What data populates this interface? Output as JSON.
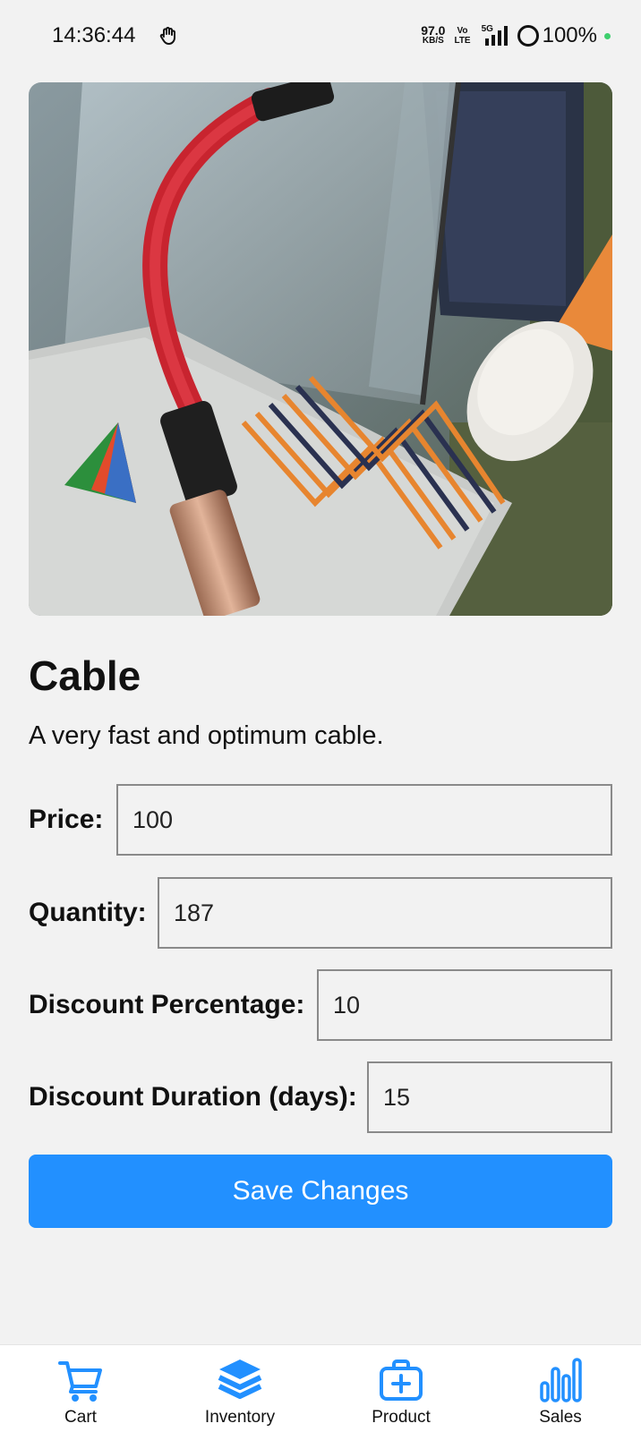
{
  "status_bar": {
    "time": "14:36:44",
    "net_speed_value": "97.0",
    "net_speed_unit": "KB/S",
    "volte_top": "Vo",
    "volte_bottom": "LTE",
    "network": "5G",
    "battery": "100%"
  },
  "product": {
    "image_icon": "product-photo-cable",
    "title": "Cable",
    "description": "A very fast and optimum cable."
  },
  "form": {
    "price": {
      "label": "Price:",
      "value": "100"
    },
    "quantity": {
      "label": "Quantity:",
      "value": "187"
    },
    "discount_percentage": {
      "label": "Discount Percentage:",
      "value": "10"
    },
    "discount_duration": {
      "label": "Discount Duration (days):",
      "value": "15"
    }
  },
  "save_label": "Save Changes",
  "nav": {
    "items": [
      {
        "label": "Cart",
        "icon": "cart-icon"
      },
      {
        "label": "Inventory",
        "icon": "layers-icon"
      },
      {
        "label": "Product",
        "icon": "medical-bag-icon"
      },
      {
        "label": "Sales",
        "icon": "bar-chart-icon"
      }
    ]
  },
  "colors": {
    "accent": "#2290ff",
    "background": "#f2f2f2",
    "nav_background": "#ffffff"
  }
}
